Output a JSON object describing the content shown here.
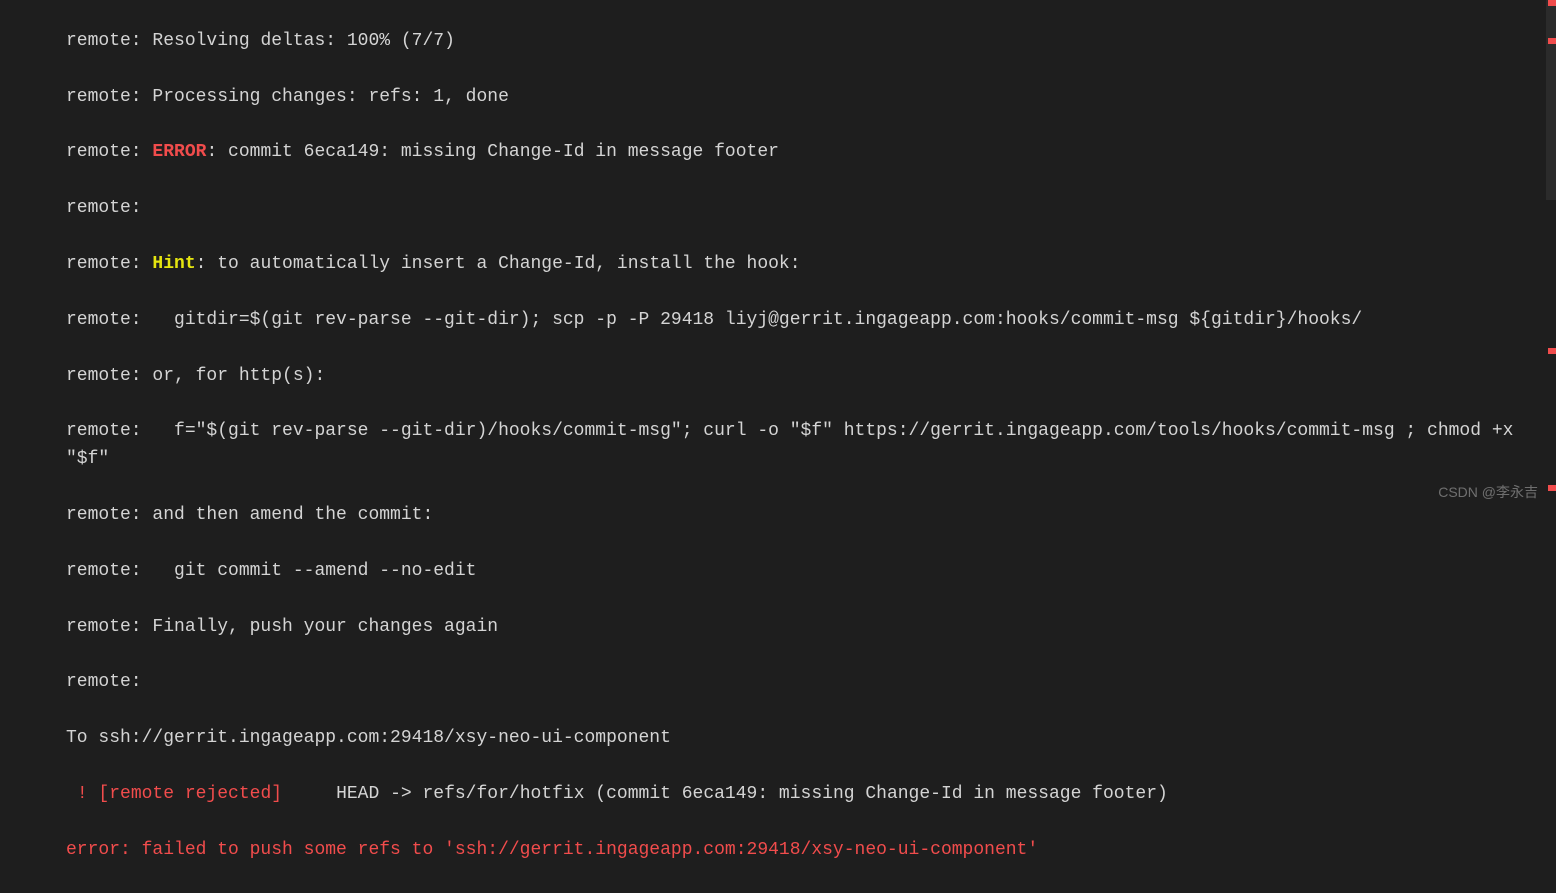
{
  "terminal": {
    "line1_prefix": "remote: ",
    "line1_rest": "Resolving deltas: 100% (7/7)",
    "line2_prefix": "remote: ",
    "line2_rest": "Processing changes: refs: 1, done",
    "line3_prefix": "remote: ",
    "line3_error": "ERROR",
    "line3_rest": ": commit 6eca149: missing Change-Id in message footer",
    "line4": "remote:",
    "line5_prefix": "remote: ",
    "line5_hint": "Hint",
    "line5_rest": ": to automatically insert a Change-Id, install the hook:",
    "line6": "remote:   gitdir=$(git rev-parse --git-dir); scp -p -P 29418 liyj@gerrit.ingageapp.com:hooks/commit-msg ${gitdir}/hooks/",
    "line7": "remote: or, for http(s):",
    "line8": "remote:   f=\"$(git rev-parse --git-dir)/hooks/commit-msg\"; curl -o \"$f\" https://gerrit.ingageapp.com/tools/hooks/commit-msg ; chmod +x \"$f\"",
    "line9": "remote: and then amend the commit:",
    "line10": "remote:   git commit --amend --no-edit",
    "line11": "remote: Finally, push your changes again",
    "line12": "remote:",
    "line13": "To ssh://gerrit.ingageapp.com:29418/xsy-neo-ui-component",
    "line14_rejected": " ! [remote rejected]     ",
    "line14_rest": "HEAD -> refs/for/hotfix (commit 6eca149: missing Change-Id in message footer)",
    "line15": "error: failed to push some refs to 'ssh://gerrit.ingageapp.com:29418/xsy-neo-ui-component'"
  },
  "watermark": "CSDN @李永吉"
}
